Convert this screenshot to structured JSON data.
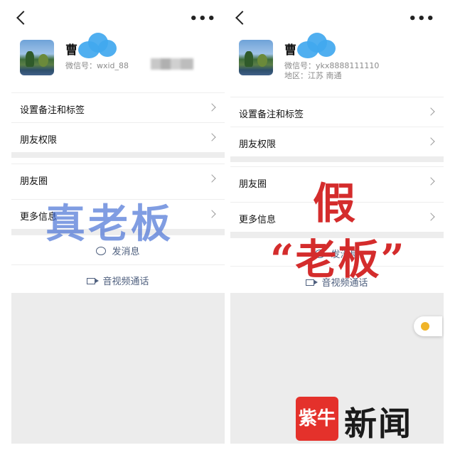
{
  "left": {
    "name": "曹",
    "id_line": "微信号：wxid_88",
    "rows": [
      "设置备注和标签",
      "朋友权限",
      "朋友圈",
      "更多信息"
    ],
    "send_message": "发消息",
    "av_call": "音视频通话",
    "overlay": "真老板"
  },
  "right": {
    "name": "曹",
    "id_line": "微信号：ykx8888111110",
    "region": "地区：江苏  南通",
    "rows": [
      "设置备注和标签",
      "朋友权限",
      "朋友圈",
      "更多信息"
    ],
    "send_message": "发消息",
    "av_call": "音视频通话",
    "overlay_1": "假",
    "overlay_2": "“老板”"
  },
  "watermark": {
    "logo_text": "紫牛",
    "brand": "新闻"
  },
  "colors": {
    "accent_link": "#4e5f7e",
    "overlay_real": "#3d69d4",
    "overlay_fake": "#d42c2c",
    "logo_red": "#e4312b"
  },
  "icons": [
    "back-icon",
    "more-icon",
    "chevron-right-icon",
    "message-icon",
    "video-call-icon"
  ]
}
